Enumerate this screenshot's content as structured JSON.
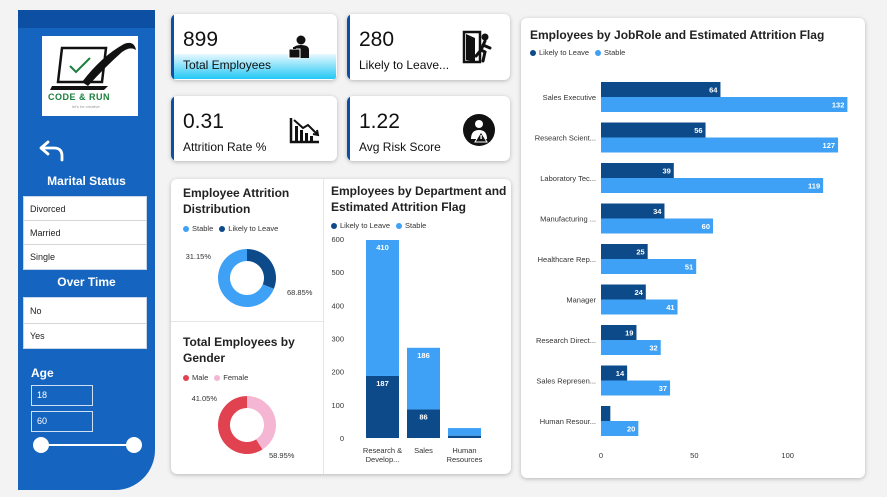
{
  "sidebar": {
    "logo_text": "CODE & RUN",
    "logo_subtext": "let's be creative",
    "marital_status": {
      "title": "Marital Status",
      "options": [
        "Divorced",
        "Married",
        "Single"
      ]
    },
    "over_time": {
      "title": "Over Time",
      "options": [
        "No",
        "Yes"
      ]
    },
    "age": {
      "title": "Age",
      "min": "18",
      "max": "60"
    }
  },
  "kpis": [
    {
      "value": "899",
      "label": "Total Employees",
      "icon": "employee-icon"
    },
    {
      "value": "280",
      "label": "Likely to Leave...",
      "icon": "exit-door-icon"
    },
    {
      "value": "0.31",
      "label": "Attrition Rate %",
      "icon": "declining-chart-icon"
    },
    {
      "value": "1.22",
      "label": "Avg Risk Score",
      "icon": "warning-person-icon"
    }
  ],
  "colors": {
    "likely": "#0d4a8a",
    "stable": "#3fa1f5",
    "male": "#e0424f",
    "female": "#f4b6d2",
    "sidebar": "#1565c0"
  },
  "attrition_distribution": {
    "title_line1": "Employee Attrition",
    "title_line2": "Distribution",
    "legend": [
      "Stable",
      "Likely to Leave"
    ]
  },
  "gender": {
    "title_line1": "Total Employees by",
    "title_line2": "Gender",
    "legend": [
      "Male",
      "Female"
    ]
  },
  "department": {
    "title_line1": "Employees by Department and",
    "title_line2": "Estimated Attrition Flag",
    "legend": [
      "Likely to Leave",
      "Stable"
    ]
  },
  "jobrole": {
    "title": "Employees by JobRole and Estimated Attrition Flag",
    "legend": [
      "Likely to Leave",
      "Stable"
    ]
  },
  "chart_data": [
    {
      "type": "pie",
      "title": "Employee Attrition Distribution",
      "slices": [
        {
          "name": "Stable",
          "value": 68.85,
          "label": "68.85%"
        },
        {
          "name": "Likely to Leave",
          "value": 31.15,
          "label": "31.15%"
        }
      ],
      "donut": true,
      "legend": "top-left"
    },
    {
      "type": "pie",
      "title": "Total Employees by Gender",
      "slices": [
        {
          "name": "Male",
          "value": 58.95,
          "label": "58.95%"
        },
        {
          "name": "Female",
          "value": 41.05,
          "label": "41.05%"
        }
      ],
      "donut": true,
      "legend": "top-left"
    },
    {
      "type": "bar",
      "stacked": true,
      "title": "Employees by Department and Estimated Attrition Flag",
      "categories": [
        "Research & Develop...",
        "Sales",
        "Human Resources"
      ],
      "series": [
        {
          "name": "Likely to Leave",
          "values": [
            187,
            86,
            7
          ]
        },
        {
          "name": "Stable",
          "values": [
            410,
            186,
            23
          ]
        }
      ],
      "data_labels": [
        [
          "187",
          "86",
          ""
        ],
        [
          "410",
          "186",
          ""
        ]
      ],
      "yticks": [
        0,
        100,
        200,
        300,
        400,
        500,
        600
      ],
      "ylim": [
        0,
        600
      ],
      "grid": false,
      "legend": "top-left"
    },
    {
      "type": "bar",
      "orientation": "horizontal",
      "title": "Employees by JobRole and Estimated Attrition Flag",
      "categories": [
        "Sales Executive",
        "Research Scient...",
        "Laboratory Tec...",
        "Manufacturing ...",
        "Healthcare Rep...",
        "Manager",
        "Research Direct...",
        "Sales Represen...",
        "Human Resour..."
      ],
      "series": [
        {
          "name": "Likely to Leave",
          "values": [
            64,
            56,
            39,
            34,
            25,
            24,
            19,
            14,
            5
          ]
        },
        {
          "name": "Stable",
          "values": [
            132,
            127,
            119,
            60,
            51,
            41,
            32,
            37,
            20
          ]
        }
      ],
      "data_labels": [
        [
          "64",
          "56",
          "39",
          "34",
          "25",
          "24",
          "19",
          "14",
          ""
        ],
        [
          "132",
          "127",
          "119",
          "60",
          "51",
          "41",
          "32",
          "37",
          "20"
        ]
      ],
      "xticks": [
        0,
        50,
        100
      ],
      "xlim": [
        0,
        135
      ],
      "grid": false,
      "legend": "top-left"
    }
  ]
}
